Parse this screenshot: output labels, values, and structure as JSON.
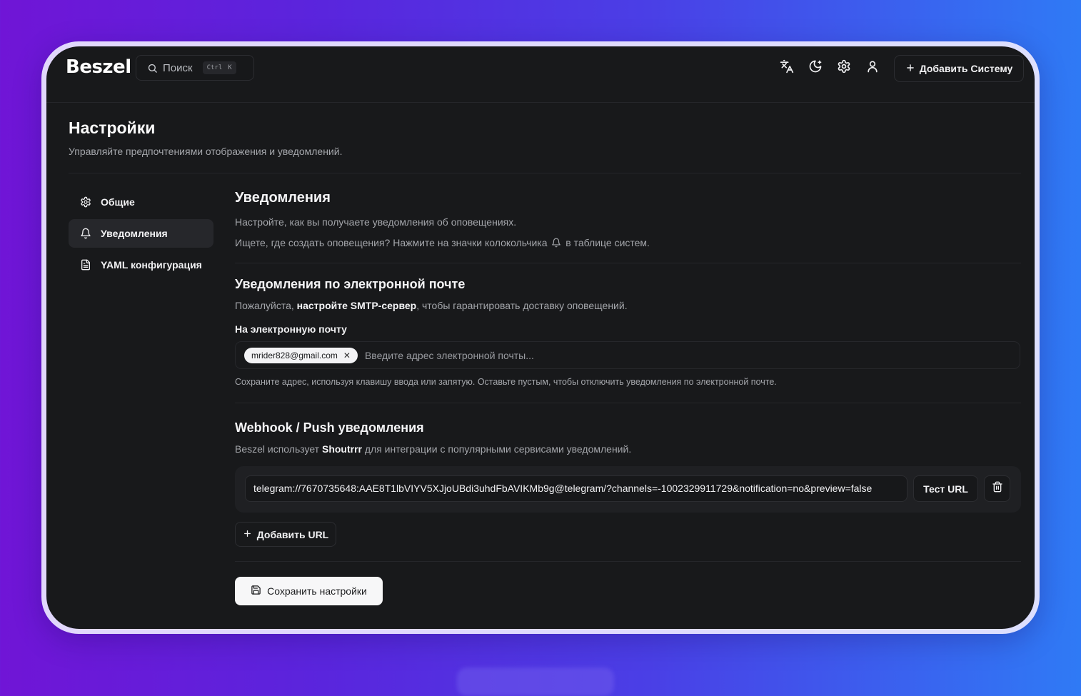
{
  "app": {
    "logo": "Beszel"
  },
  "search": {
    "label": "Поиск",
    "shortcut_ctrl": "Ctrl",
    "shortcut_key": "K"
  },
  "header": {
    "icons": [
      "translate-icon",
      "moon-icon",
      "gear-icon",
      "user-icon"
    ],
    "add_system_label": "Добавить Систему"
  },
  "page": {
    "title": "Настройки",
    "subtitle": "Управляйте предпочтениями отображения и уведомлений."
  },
  "sidebar": {
    "items": [
      {
        "label": "Общие",
        "icon": "gear-icon",
        "active": false
      },
      {
        "label": "Уведомления",
        "icon": "bell-icon",
        "active": true
      },
      {
        "label": "YAML конфигурация",
        "icon": "file-icon",
        "active": false
      }
    ]
  },
  "notifications": {
    "title": "Уведомления",
    "desc1": "Настройте, как вы получаете уведомления об оповещениях.",
    "desc2_before": "Ищете, где создать оповещения? Нажмите на значки колокольчика",
    "desc2_after": "в таблице систем."
  },
  "email": {
    "title": "Уведомления по электронной почте",
    "desc_before": "Пожалуйста,",
    "desc_link": "настройте SMTP-сервер",
    "desc_after": ", чтобы гарантировать доставку оповещений.",
    "field_label": "На электронную почту",
    "chips": [
      "mrider828@gmail.com"
    ],
    "placeholder": "Введите адрес электронной почты...",
    "hint": "Сохраните адрес, используя клавишу ввода или запятую. Оставьте пустым, чтобы отключить уведомления по электронной почте."
  },
  "webhook": {
    "title": "Webhook / Push уведомления",
    "desc_before": "Beszel использует",
    "desc_link": "Shoutrrr",
    "desc_after": "для интеграции с популярными сервисами уведомлений.",
    "url_value": "telegram://7670735648:AAE8T1lbVIYV5XJjoUBdi3uhdFbAVIKMb9g@telegram/?channels=-1002329911729&notification=no&preview=false",
    "test_label": "Тест URL",
    "add_url_label": "Добавить URL"
  },
  "save_label": "Сохранить настройки"
}
